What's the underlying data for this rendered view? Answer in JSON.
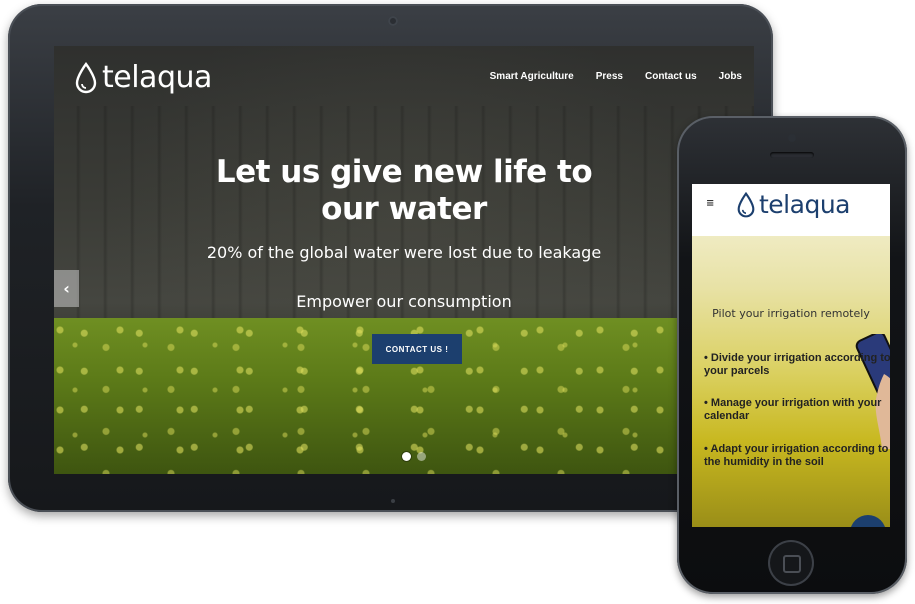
{
  "tablet": {
    "logo_text": "telaqua",
    "nav": [
      "Smart Agriculture",
      "Press",
      "Contact us",
      "Jobs"
    ],
    "hero": {
      "title": "Let us give new life to our water",
      "subtitle": "20% of the global water were lost due to leakage",
      "tagline": "Empower our consumption",
      "cta": "CONTACT US !"
    },
    "carousel": {
      "active": 1,
      "count": 2
    }
  },
  "phone": {
    "logo_text": "telaqua",
    "headline": "Pilot your irrigation remotely",
    "bullets": [
      "Divide your irrigation according to your parcels",
      "Manage your irrigation with your calendar",
      "Adapt your irrigation according to the humidity in the soil"
    ]
  },
  "colors": {
    "brand_navy": "#1c3f6e",
    "white": "#ffffff"
  }
}
